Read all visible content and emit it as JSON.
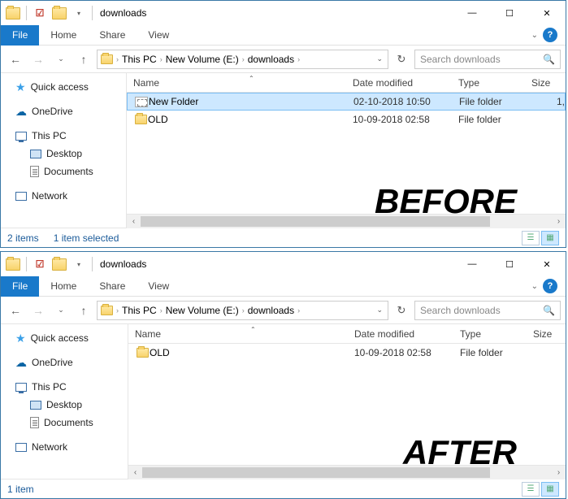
{
  "windows": [
    {
      "title": "downloads",
      "overlay": "BEFORE",
      "tabs": {
        "file": "File",
        "home": "Home",
        "share": "Share",
        "view": "View"
      },
      "breadcrumb": [
        "This PC",
        "New Volume (E:)",
        "downloads"
      ],
      "search_placeholder": "Search downloads",
      "sidebar": {
        "quick_access": "Quick access",
        "onedrive": "OneDrive",
        "this_pc": "This PC",
        "desktop": "Desktop",
        "documents": "Documents",
        "network": "Network"
      },
      "columns": {
        "name": "Name",
        "date": "Date modified",
        "type": "Type",
        "size": "Size"
      },
      "rows": [
        {
          "name": "New Folder",
          "date": "02-10-2018 10:50",
          "type": "File folder",
          "size": "1,",
          "selected": true,
          "icon": "new"
        },
        {
          "name": "OLD",
          "date": "10-09-2018 02:58",
          "type": "File folder",
          "size": "",
          "selected": false,
          "icon": "folder"
        }
      ],
      "status": {
        "count": "2 items",
        "selection": "1 item selected"
      }
    },
    {
      "title": "downloads",
      "overlay": "AFTER",
      "tabs": {
        "file": "File",
        "home": "Home",
        "share": "Share",
        "view": "View"
      },
      "breadcrumb": [
        "This PC",
        "New Volume (E:)",
        "downloads"
      ],
      "search_placeholder": "Search downloads",
      "sidebar": {
        "quick_access": "Quick access",
        "onedrive": "OneDrive",
        "this_pc": "This PC",
        "desktop": "Desktop",
        "documents": "Documents",
        "network": "Network"
      },
      "columns": {
        "name": "Name",
        "date": "Date modified",
        "type": "Type",
        "size": "Size"
      },
      "rows": [
        {
          "name": "OLD",
          "date": "10-09-2018 02:58",
          "type": "File folder",
          "size": "",
          "selected": false,
          "icon": "folder"
        }
      ],
      "status": {
        "count": "1 item",
        "selection": ""
      }
    }
  ]
}
